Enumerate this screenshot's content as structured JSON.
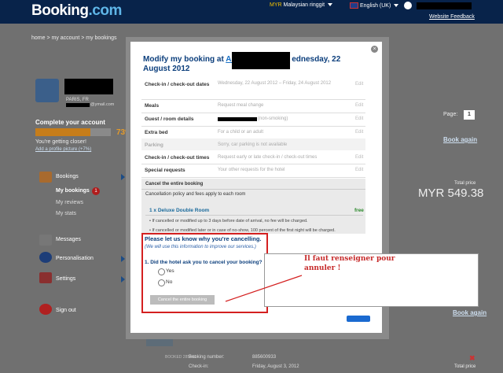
{
  "header": {
    "logo_main": "Booking",
    "logo_ext": ".com",
    "currency_code": "MYR",
    "currency_name": "Malaysian ringgit",
    "language": "English (UK)",
    "feedback": "Website Feedback"
  },
  "breadcrumb": "home > my account > my bookings",
  "profile": {
    "city": "PARIS, FR",
    "email_suffix": "@ymail.com",
    "complete_title": "Complete your account",
    "complete_progress": 0.73,
    "complete_pct": "73%",
    "getting_closer": "You're getting closer!",
    "add_picture": "Add a profile picture (+7%)"
  },
  "sidebar": {
    "bookings": "Bookings",
    "my_bookings": "My bookings",
    "my_bookings_count": "1",
    "my_reviews": "My reviews",
    "my_stats": "My stats",
    "messages": "Messages",
    "personalisation": "Personalisation",
    "settings": "Settings",
    "sign_out": "Sign out"
  },
  "bg": {
    "page_label": "Page:",
    "page_num": "1",
    "book_again": "Book again",
    "total_price": "Total price",
    "price": "MYR 549.38",
    "booking_number_label": "Booking number:",
    "booking_number": "885600933",
    "checkin_label": "Check-in:",
    "checkin_value": "Friday, August 3, 2012",
    "booked_label": "BOOKED 285443",
    "close": "✖"
  },
  "modal": {
    "close": "×",
    "title_pre": "Modify my booking at ",
    "title_link": "Al",
    "title_post": "ednesday, 22 August 2012",
    "rows": [
      {
        "label": "Check-in / check-out dates",
        "value": "Wednesday, 22 August 2012 – Friday, 24 August 2012",
        "edit": "Edit"
      },
      {
        "label": "Meals",
        "value": "Request meal change",
        "edit": "Edit"
      },
      {
        "label": "Guest / room details",
        "value": "(non-smoking)",
        "edit": "Edit"
      },
      {
        "label": "Extra bed",
        "value": "For a child or an adult",
        "edit": "Edit"
      },
      {
        "label": "Parking",
        "value": "Sorry, car parking is not available",
        "edit": ""
      },
      {
        "label": "Check-in / check-out times",
        "value": "Request early or late check-in / check-out times",
        "edit": "Edit"
      },
      {
        "label": "Special requests",
        "value": "Your other requests for the hotel",
        "edit": "Edit"
      }
    ],
    "cancel_title": "Cancel the entire booking",
    "cancel_policy": "Cancellation policy and fees apply to each room",
    "room": "1 x Deluxe Double Room",
    "room_fee": "free",
    "policy_1": "If cancelled or modified up to 3 days before date of arrival, no fee will be charged.",
    "policy_2": "If cancelled or modified later or in case of no-show, 100 percent of the first night will be charged.",
    "reason_title": "Please let us know why you're cancelling.",
    "reason_sub": "(We will use this information to improve our services.)",
    "question": "1.  Did the hotel ask you to cancel your booking?",
    "yes": "Yes",
    "no": "No",
    "cancel_button": "Cancel the entire booking"
  },
  "annotation": {
    "line1": "Il faut renseigner pour",
    "line2": "annuler !"
  }
}
